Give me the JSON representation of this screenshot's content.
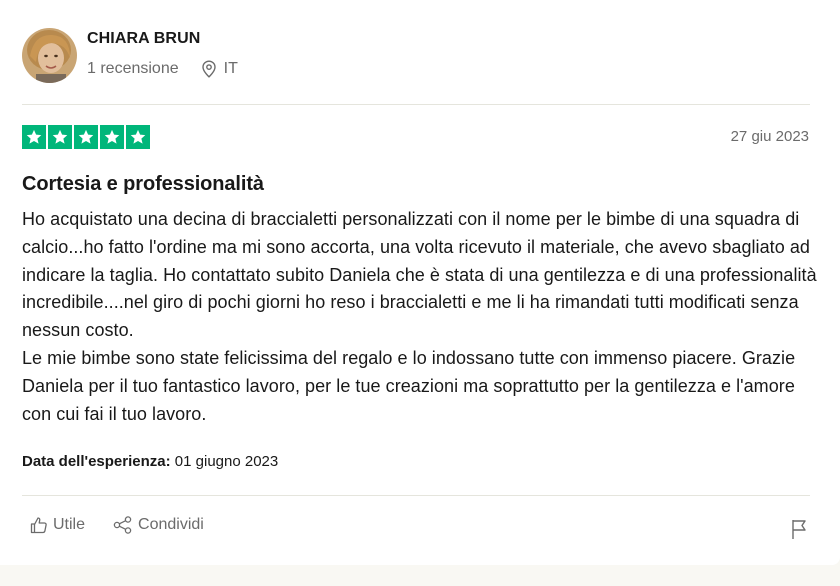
{
  "reviewer": {
    "name": "CHIARA BRUN",
    "reviews_count": "1 recensione",
    "country": "IT",
    "avatar_icon": "user-avatar-photo"
  },
  "review": {
    "rating": 5,
    "rating_max": 5,
    "star_color": "#00b67a",
    "date": "27 giu 2023",
    "title": "Cortesia e professionalità",
    "paragraphs": [
      "Ho acquistato una decina di braccialetti personalizzati con il nome per le bimbe di una squadra di calcio...ho fatto l'ordine ma mi sono accorta, una volta ricevuto il materiale, che avevo sbagliato ad indicare la taglia. Ho contattato subito Daniela che è stata di una gentilezza e di una professionalità incredibile....nel giro di pochi giorni ho reso i braccialetti e me li ha rimandati tutti modificati senza nessun costo.",
      "Le mie bimbe sono state felicissima del regalo e lo indossano tutte con immenso piacere. Grazie Daniela per il tuo fantastico lavoro, per le tue creazioni ma soprattutto per la gentilezza e l'amore con cui fai il tuo lavoro."
    ],
    "experience_label": "Data dell'esperienza:",
    "experience_date": "01 giugno 2023"
  },
  "actions": {
    "useful_label": "Utile",
    "share_label": "Condividi",
    "useful_icon": "thumbs-up-icon",
    "share_icon": "share-icon",
    "report_icon": "flag-icon"
  }
}
